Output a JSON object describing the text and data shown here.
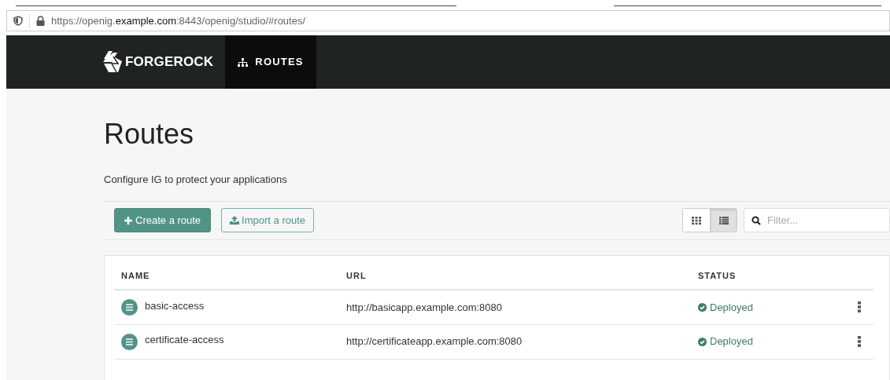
{
  "address_bar": {
    "url": "https://openig.**example.com**:8443/openig/studio/#routes/"
  },
  "navbar": {
    "logo": "FORGEROCK",
    "tabs": [
      {
        "label": "ROUTES",
        "selected": true
      }
    ]
  },
  "page": {
    "title": "Routes",
    "subtitle": "Configure IG to protect your applications"
  },
  "toolbar": {
    "buttons": [
      {
        "label": "Create a route",
        "kind": "primary"
      },
      {
        "label": "Import a route",
        "kind": "secondary"
      }
    ],
    "view_toggle": [
      {
        "kind": "grid",
        "selected": false
      },
      {
        "kind": "list",
        "selected": true
      }
    ],
    "filter": {
      "placeholder": "Filter..."
    }
  },
  "table": {
    "columns": [
      "NAME",
      "URL",
      "STATUS"
    ],
    "rows": [
      {
        "name": "basic-access",
        "url": "http://basicapp.example.com:8080",
        "status": "Deployed"
      },
      {
        "name": "certificate-access",
        "url": "http://certificateapp.example.com:8080",
        "status": "Deployed"
      }
    ]
  }
}
